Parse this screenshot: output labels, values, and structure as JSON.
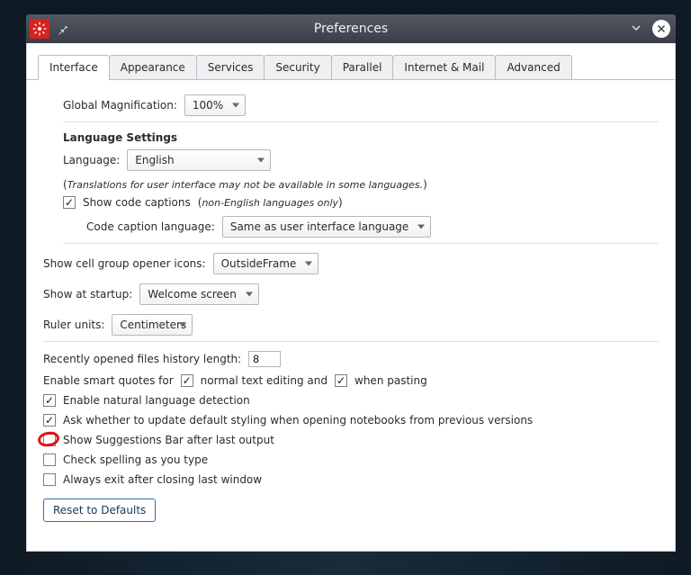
{
  "title": "Preferences",
  "tabs": [
    "Interface",
    "Appearance",
    "Services",
    "Security",
    "Parallel",
    "Internet & Mail",
    "Advanced"
  ],
  "active_tab": 0,
  "magnification": {
    "label": "Global Magnification:",
    "value": "100%"
  },
  "lang_header": "Language Settings",
  "language": {
    "label": "Language:",
    "value": "English"
  },
  "translations_note_open": "(",
  "translations_note": "Translations for user interface may not be available in some languages.",
  "translations_note_close": ")",
  "show_code_captions": {
    "label": "Show code captions",
    "paren_open": "(",
    "sub": "non-English languages only",
    "paren_close": ")",
    "checked": true
  },
  "code_caption_lang": {
    "label": "Code caption language:",
    "value": "Same as user interface language"
  },
  "group_opener": {
    "label": "Show cell group opener icons:",
    "value": "OutsideFrame"
  },
  "show_at_startup": {
    "label": "Show at startup:",
    "value": "Welcome screen"
  },
  "ruler_units": {
    "label": "Ruler units:",
    "value": "Centimeters"
  },
  "history": {
    "label": "Recently opened files history length:",
    "value": "8"
  },
  "smart_quotes": {
    "prefix": "Enable smart quotes for",
    "normal_checked": true,
    "normal_label": "normal text editing and",
    "pasting_checked": true,
    "pasting_label": "when pasting"
  },
  "checks": {
    "natural_lang": {
      "checked": true,
      "label": "Enable natural language detection"
    },
    "update_styling": {
      "checked": true,
      "label": "Ask whether to update default styling when opening notebooks from previous versions"
    },
    "suggestions_bar": {
      "checked": false,
      "label": "Show Suggestions Bar after last output"
    },
    "spell": {
      "checked": false,
      "label": "Check spelling as you type"
    },
    "exit_last": {
      "checked": false,
      "label": "Always exit after closing last window"
    }
  },
  "reset_label": "Reset to Defaults"
}
